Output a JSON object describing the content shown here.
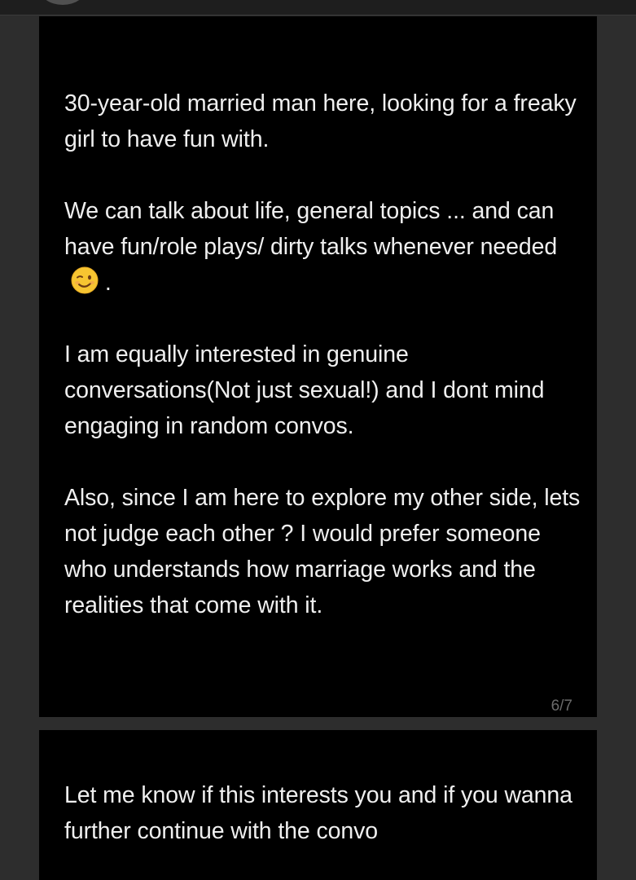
{
  "post": {
    "paragraphs": [
      "30-year-old married man here, looking for a freaky girl to have fun with.",
      "We can talk about  life, general topics ... and can have fun/role plays/ dirty talks whenever needed",
      "I am equally interested in genuine conversations(Not just sexual!)  and I dont mind engaging in random convos.",
      "Also, since I am here to explore my other side, lets not judge each other ?  I would prefer someone who understands how marriage works and the realities that come with it."
    ],
    "emoji_after_p2": "wink-emoji",
    "p2_trailing": " .",
    "page_counter": "6/7"
  },
  "next_post": {
    "text": "Let me know if this interests you and if you wanna further  continue with the convo"
  },
  "colors": {
    "page_background": "#2d2d2d",
    "card_background": "#000000",
    "text": "#efefef",
    "counter_text": "#6b6b6b"
  }
}
